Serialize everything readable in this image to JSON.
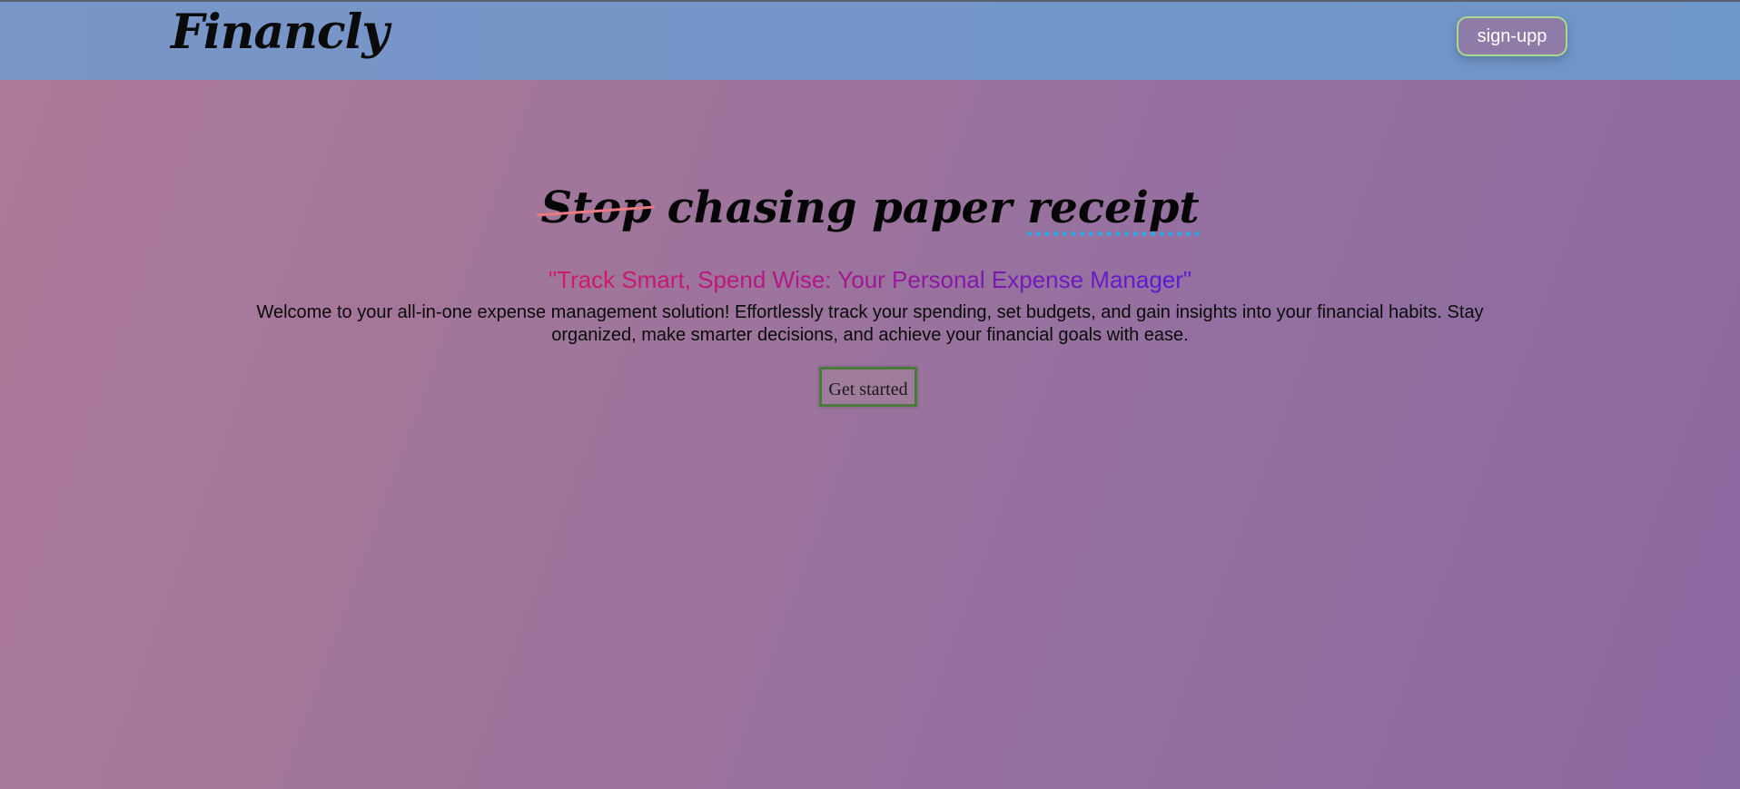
{
  "header": {
    "logo_text": "Financly",
    "signup_label": "sign-upp"
  },
  "hero": {
    "title_strike": "Stop",
    "title_middle": " chasing paper ",
    "title_underline": "receipt",
    "tagline": "\"Track Smart, Spend Wise: Your Personal Expense Manager\"",
    "description": "Welcome to your all-in-one expense management solution! Effortlessly track your spending, set budgets, and gain insights into your financial habits. Stay organized, make smarter decisions, and achieve your financial goals with ease.",
    "cta_label": "Get started"
  },
  "colors": {
    "header_bg": "#7396c8",
    "strike_color": "#ea7a84",
    "underline_dots": "#2aa8e8",
    "tagline_start": "#d21b64",
    "tagline_end": "#5a1ad8",
    "button_border": "#4a7a3c"
  }
}
